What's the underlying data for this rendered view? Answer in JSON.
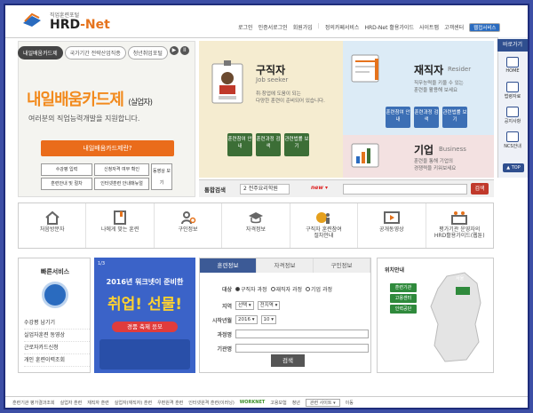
{
  "header": {
    "logo_sub": "직업훈련포털",
    "logo_main_a": "HRD",
    "logo_main_b": "-Net",
    "nav": [
      "로그인",
      "인증서로그인",
      "회원가입",
      "정의카페서비스",
      "HRD-Net 활용가이드",
      "사이트맵",
      "고객센터",
      "웹접서비스"
    ]
  },
  "banner": {
    "tabs": [
      "내일배움카드제",
      "국가기간 전략산업직종",
      "청년취업포털"
    ],
    "play": "▶",
    "pause": "II",
    "title": "내일배움카드제",
    "title_suffix": "(실업자)",
    "subtitle": "여러분의 직업능력개발을 지원합니다.",
    "main_button": "내일배움카드제란?",
    "buttons": [
      "수강평 입력",
      "신청자격 여부 확인",
      "동영상 보기",
      "훈련안내 및 절차",
      "인터넷훈련 안내매뉴얼"
    ]
  },
  "seeker": {
    "title": "구직자",
    "english": "Job seeker",
    "desc": "취·창업에 도움이 되는\n다양한 훈련이 준비되어 있습니다.",
    "buttons": [
      "훈련참여 안내",
      "훈련과정 검색",
      "관련법률 보기"
    ]
  },
  "employed": {
    "title": "재직자",
    "english": "Resider",
    "desc": "직무능력을 키울 수 있는\n훈련을 활용해 보세요",
    "buttons": [
      "훈련참여 안내",
      "훈련과정 검색",
      "관련법률 보기"
    ]
  },
  "corporate": {
    "title": "기업",
    "english": "Business",
    "desc": "훈련을 통해 기업의\n경쟁력을 키워보세요"
  },
  "search": {
    "label": "통합검색",
    "select_value": "전주요리학원",
    "select_number": "2",
    "new_label": "new",
    "button": "검색"
  },
  "quickbar": {
    "title": "바로가기",
    "items": [
      "HOME",
      "법령자료",
      "공지사항",
      "NCS안내"
    ],
    "top": "▲ TOP"
  },
  "icons": [
    {
      "label": "처음방문자",
      "icon": "house-icon"
    },
    {
      "label": "나에게 맞는 훈련",
      "icon": "book-icon"
    },
    {
      "label": "구인정보",
      "icon": "people-search-icon"
    },
    {
      "label": "자격정보",
      "icon": "graduation-cap-icon"
    },
    {
      "label": "구직자 훈련참여\n절차안내",
      "icon": "globe-person-icon"
    },
    {
      "label": "공개동영상",
      "icon": "video-icon"
    },
    {
      "label": "평가기관 운영자의\nHRD활용가이드(웹툰)",
      "icon": "people-group-icon"
    }
  ],
  "quick_service": {
    "title": "빠른서비스",
    "items": [
      "수강평 남기기",
      "실업자훈련 동영상",
      "근로자카드신청",
      "개인 훈련이력조회"
    ]
  },
  "promo": {
    "pager": "1/3",
    "line1": "2016년 워크넷이 준비한",
    "line2": "취업! 선물!",
    "line3": "경품 축제 응모"
  },
  "course_form": {
    "tabs": [
      "훈련정보",
      "자격정보",
      "구인정보"
    ],
    "target_label": "대상",
    "target_options": [
      "구직자 과정",
      "재직자 과정",
      "기업 과정"
    ],
    "target_selected": 0,
    "region_label": "지역",
    "region_values": [
      "선택",
      "전지역"
    ],
    "start_label": "시작년월",
    "start_year": "2016",
    "start_month": "10",
    "course_label": "과정명",
    "org_label": "기관명",
    "search_button": "검색"
  },
  "map": {
    "title": "위치안내",
    "region_tag": "서울",
    "buttons": [
      "훈련기관",
      "고용센터",
      "인력공단"
    ]
  },
  "footer": {
    "items": [
      "훈련기관 평가결과조회",
      "실업자 훈련",
      "재직자 훈련",
      "실업자(재직자) 훈련",
      "우편원격 훈련",
      "인터넷원격 훈련(이러닝)"
    ],
    "logos": [
      "WORKNET",
      "고용보험",
      "청년"
    ],
    "select": "관련 사이트",
    "go": "이동"
  },
  "colors": {
    "accent": "#2a6bbf",
    "brand_orange": "#ea6c1b",
    "green": "#3c6e36"
  }
}
